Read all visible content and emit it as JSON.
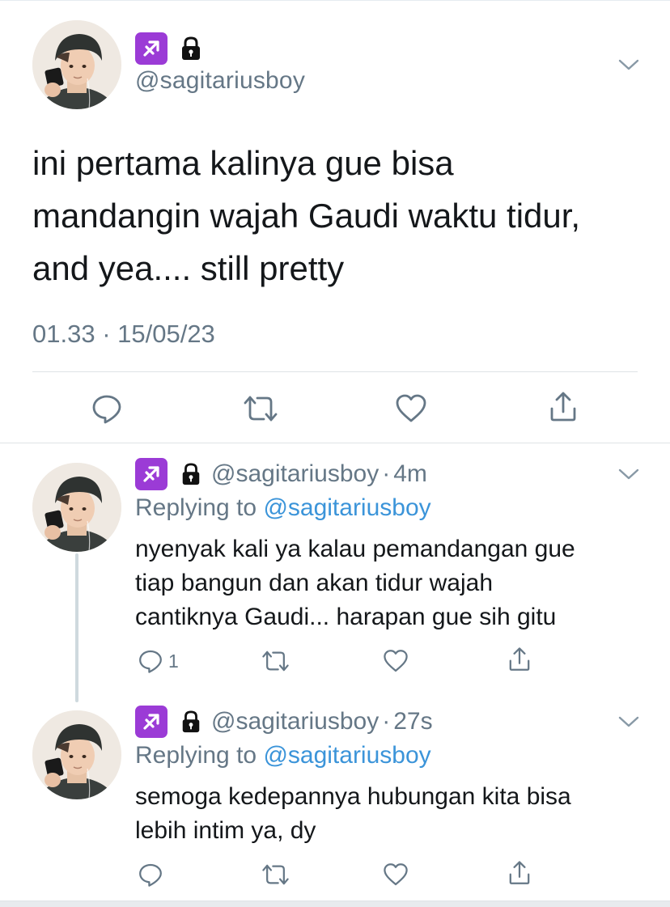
{
  "main_tweet": {
    "zodiac_icon": "sagittarius-icon",
    "lock_icon": "lock-icon",
    "handle": "@sagitariusboy",
    "text_lines": [
      "ini pertama kalinya gue bisa",
      "mandangin wajah Gaudi waktu tidur,",
      "and yea.... still pretty"
    ],
    "timestamp": "01.33 · 15/05/23",
    "actions": [
      "reply-icon",
      "retweet-icon",
      "like-icon",
      "share-icon"
    ]
  },
  "replies": [
    {
      "handle": "@sagitariusboy",
      "dot": "·",
      "time": "4m",
      "replying_prefix": "Replying to ",
      "replying_to": "@sagitariusboy",
      "text_lines": [
        "nyenyak kali ya kalau pemandangan gue",
        "tiap bangun dan akan tidur wajah",
        "cantiknya Gaudi... harapan gue sih gitu"
      ],
      "reply_count": "1"
    },
    {
      "handle": "@sagitariusboy",
      "dot": "·",
      "time": "27s",
      "replying_prefix": "Replying to ",
      "replying_to": "@sagitariusboy",
      "text_lines": [
        "semoga kedepannya hubungan kita bisa",
        "lebih intim ya, dy"
      ],
      "reply_count": ""
    }
  ],
  "colors": {
    "zodiac_bg": "#9b3bd6",
    "muted_text": "#657786",
    "mention": "#3b94d9",
    "divider": "#dfe3e6"
  }
}
